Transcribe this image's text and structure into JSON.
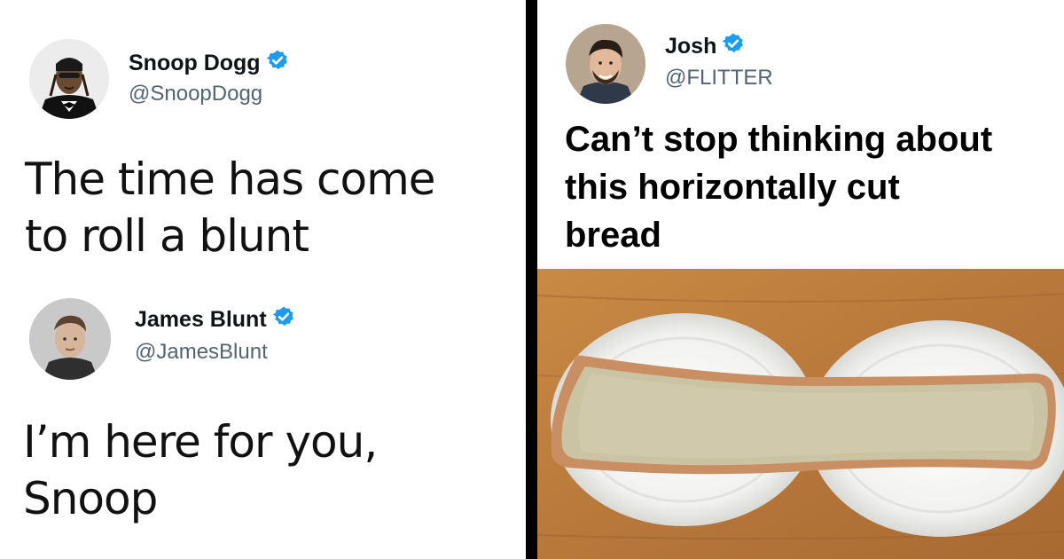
{
  "tweets": [
    {
      "name": "Snoop Dogg",
      "handle": "@SnoopDogg",
      "verified": true,
      "text_lines": [
        "The time has come",
        "to roll a blunt"
      ]
    },
    {
      "name": "James Blunt",
      "handle": "@JamesBlunt",
      "verified": true,
      "text_lines": [
        "I’m here for you,",
        "Snoop"
      ]
    },
    {
      "name": "Josh",
      "handle": "@FLITTER",
      "verified": true,
      "text_lines": [
        "Can’t stop thinking about",
        "this horizontally cut",
        "bread"
      ]
    }
  ],
  "colors": {
    "verified_badge": "#1d9bf0",
    "handle_gray": "#536471",
    "divider": "#000000"
  },
  "icons": {
    "verified": "verified-badge-icon"
  }
}
